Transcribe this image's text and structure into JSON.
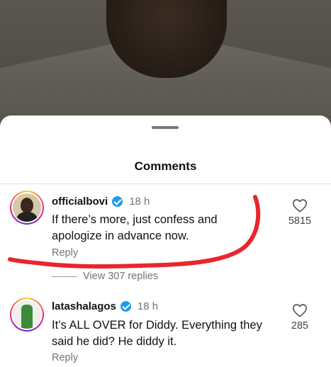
{
  "sheet": {
    "title": "Comments"
  },
  "comments": [
    {
      "username": "officialbovi",
      "time": "18 h",
      "text": "If there’s more, just confess and apologize in advance now.",
      "reply_label": "Reply",
      "likes": "5815",
      "view_replies": "View 307 replies"
    },
    {
      "username": "latashalagos",
      "time": "18 h",
      "text": "It’s ALL OVER for Diddy. Everything they said he did? He diddy it.",
      "reply_label": "Reply",
      "likes": "285"
    }
  ],
  "colors": {
    "annotation_stroke": "#e8262b",
    "verified": "#1d9bf0"
  },
  "icons": {
    "like": "heart-outline-icon",
    "verified": "verified-badge-icon"
  }
}
